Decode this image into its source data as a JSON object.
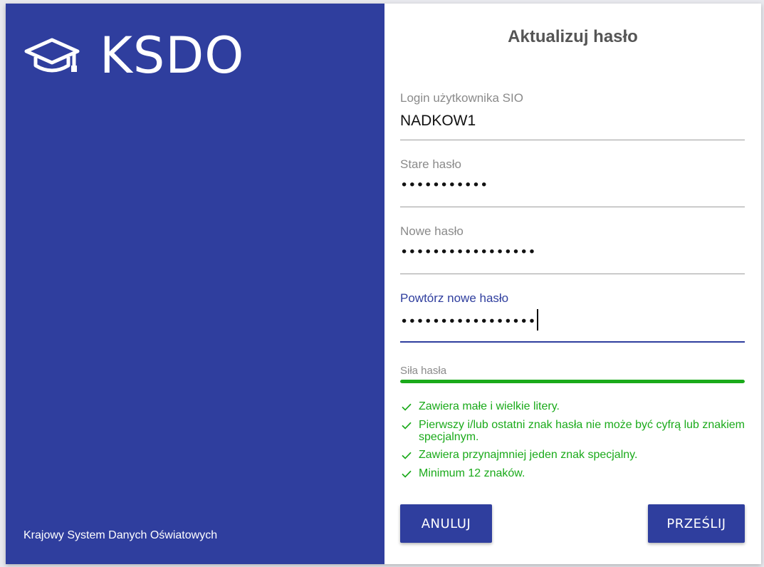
{
  "theme": {
    "brand": "#2f3e9e",
    "ok": "#1aaa1a"
  },
  "brand": {
    "logo_text": "KSDO",
    "footer": "Krajowy System Danych Oświatowych"
  },
  "form": {
    "title": "Aktualizuj hasło",
    "login": {
      "label": "Login użytkownika SIO",
      "value": "NADKOW1"
    },
    "old_password": {
      "label": "Stare hasło",
      "value": "•••••••••••"
    },
    "new_password": {
      "label": "Nowe hasło",
      "value": "•••••••••••••••••"
    },
    "repeat_password": {
      "label": "Powtórz nowe hasło",
      "value": "•••••••••••••••••"
    },
    "strength": {
      "label": "Siła hasła",
      "level_percent": 100
    },
    "rules": [
      "Zawiera małe i wielkie litery.",
      "Pierwszy i/lub ostatni znak hasła nie może być cyfrą lub znakiem specjalnym.",
      "Zawiera przynajmniej jeden znak specjalny.",
      "Minimum 12 znaków."
    ],
    "cancel_label": "ANULUJ",
    "submit_label": "PRZEŚLIJ"
  }
}
